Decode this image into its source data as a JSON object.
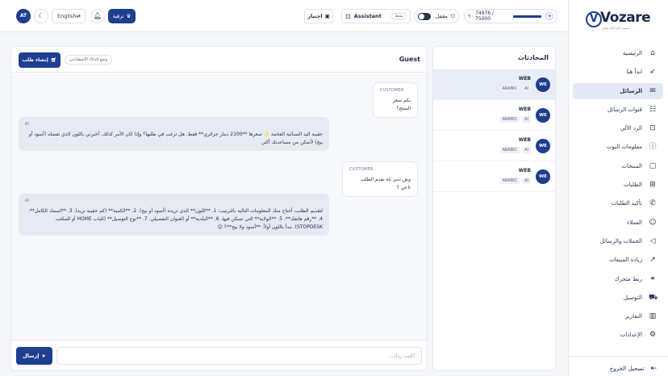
{
  "brand": {
    "name": "Vozare",
    "tagline": "منصة ذكية لكل متجر"
  },
  "topbar": {
    "avatar_initials": "AT",
    "language": "English",
    "upgrade_label": "ترقية",
    "test_label": "اختبار",
    "assistant_name": "Assistant",
    "assistant_status": "نشط",
    "lock_label": "مقفل",
    "credits_text": "74976 / 75000",
    "credits_fraction": 0.9997
  },
  "sidebar": {
    "items": [
      {
        "label": "الرئيسية",
        "icon": "home-icon"
      },
      {
        "label": "ابدأ هنا",
        "icon": "rocket-icon"
      },
      {
        "label": "الرسائل",
        "icon": "inbox-icon",
        "active": true
      },
      {
        "label": "قنوات الرسائل",
        "icon": "channels-icon"
      },
      {
        "label": "الرد الآلي",
        "icon": "bot-icon"
      },
      {
        "label": "معلومات البوت",
        "icon": "info-icon"
      },
      {
        "label": "المنتجات",
        "icon": "box-icon"
      },
      {
        "label": "الطلبات",
        "icon": "cart-icon"
      },
      {
        "label": "تأكيد الطلبات",
        "icon": "phone-check-icon"
      },
      {
        "label": "العملاء",
        "icon": "users-icon"
      },
      {
        "label": "الحملات والرسائل",
        "icon": "megaphone-icon"
      },
      {
        "label": "زيادة المبيعات",
        "icon": "trend-icon"
      },
      {
        "label": "ربط متجرك",
        "icon": "link-icon"
      },
      {
        "label": "التوصيل",
        "icon": "truck-icon"
      },
      {
        "label": "التقارير",
        "icon": "chart-icon"
      },
      {
        "label": "الإعدادات",
        "icon": "gear-icon"
      }
    ],
    "logout_label": "تسجيل الخروج"
  },
  "conversations": {
    "title": "المحادثات",
    "items": [
      {
        "initials": "WE",
        "channel": "WEB",
        "tags": [
          "ARABIC",
          "AI"
        ],
        "active": true
      },
      {
        "initials": "WE",
        "channel": "WEB",
        "tags": [
          "ARABIC",
          "AI"
        ]
      },
      {
        "initials": "WE",
        "channel": "WEB",
        "tags": [
          "ARABIC",
          "AI"
        ]
      },
      {
        "initials": "WE",
        "channel": "WEB",
        "tags": [
          "ARABIC",
          "AI"
        ]
      }
    ]
  },
  "chat": {
    "title": "Guest",
    "create_order_label": "إنشاء طلب",
    "mode_badge": "وضع الذكاء الاصطناعي",
    "messages": [
      {
        "role": "CUSTOMER",
        "text": "بكم سعر المنتج؟"
      },
      {
        "role": "AI",
        "text": "حقيبة اليد النسائية الفخمة ✨ سعرها **2100 دينار جزائري** فقط. هل ترغب في طلبها؟ وإذا كان الأمر كذلك، أخبرني باللون الذي تفضله (أسود أو بيج) لأتمكن من مساعدتك أكثر."
      },
      {
        "role": "CUSTOMER",
        "text": "وش ندير باه نقدم الطلب تاعي ؟"
      },
      {
        "role": "AI",
        "text": "لتقديم الطلب، أحتاج منك المعلومات التالية بالترتيب: 1. **اللون** الذي تريده (أسود أو بيج). 2. **الكمية** (كم حقيبة تريد). 3. **اسمك الكامل**. 4. **رقم هاتفك**. 5. **الولاية** التي تسكن فيها. 6. **البلدية** أو العنوان التفصيلي. 7. **نوع التوصيل** (للباب HOME أو للمكتب STOPDESK). نبدأ باللون أولاً: **أسود ولا بيج**؟ 😊"
      }
    ],
    "input_placeholder": "اكتب ردك...",
    "send_label": "إرسال"
  }
}
